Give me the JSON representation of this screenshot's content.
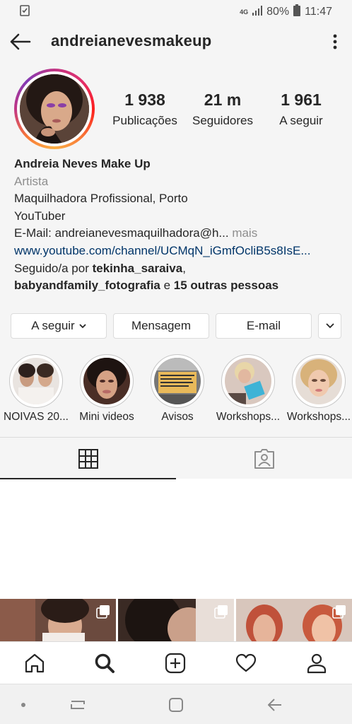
{
  "status_bar": {
    "network": "4G",
    "battery": "80%",
    "time": "11:47"
  },
  "header": {
    "username": "andreianevesmakeup",
    "icons": [
      "back-arrow-icon",
      "more-vertical-icon"
    ]
  },
  "profile": {
    "stats": [
      {
        "value": "1 938",
        "label": "Publicações"
      },
      {
        "value": "21 m",
        "label": "Seguidores"
      },
      {
        "value": "1 961",
        "label": "A seguir"
      }
    ],
    "name": "Andreia Neves Make Up",
    "category": "Artista",
    "bio_lines": [
      "Maquilhadora Profissional, Porto",
      "YouTuber"
    ],
    "email_line": "E-Mail: andreianevesmaquilhadora@h...",
    "more_label": " mais",
    "website": "www.youtube.com/channel/UCMqN_iGmfOcliB5s8IsE...",
    "followed_by": {
      "prefix": "Seguido/a por ",
      "user1": "tekinha_saraiva",
      "sep": ",",
      "user2": "babyandfamily_fotografia",
      "and": " e ",
      "others": "15 outras pessoas"
    }
  },
  "actions": {
    "following_label": "A seguir",
    "message_label": "Mensagem",
    "email_label": "E-mail"
  },
  "highlights": [
    {
      "label": "NOIVAS 20..."
    },
    {
      "label": "Mini videos"
    },
    {
      "label": "Avisos"
    },
    {
      "label": "Workshops..."
    },
    {
      "label": "Workshops..."
    }
  ],
  "tabs": [
    "grid-icon",
    "tagged-icon"
  ],
  "bottom_nav": [
    "home-icon",
    "search-icon",
    "add-icon",
    "heart-icon",
    "profile-icon"
  ],
  "colors": {
    "link": "#003569",
    "secondary": "#8e8e8e",
    "border": "#dbdbdb",
    "story_ring": "#c13584"
  }
}
